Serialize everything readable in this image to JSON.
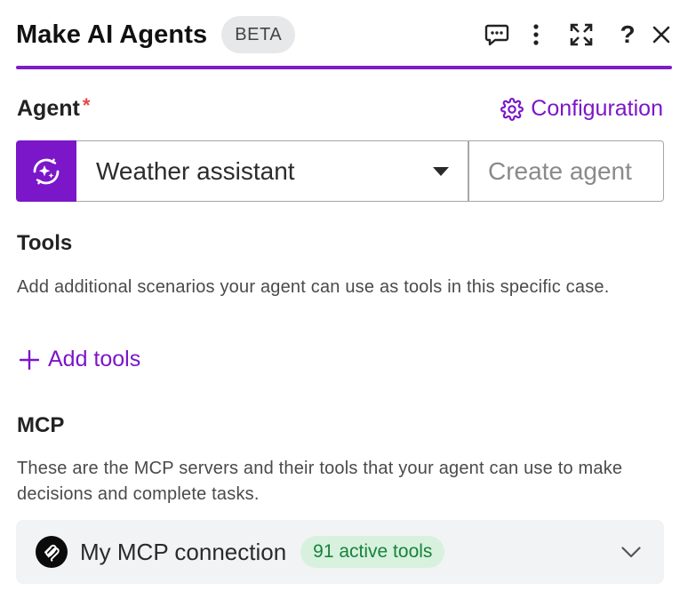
{
  "header": {
    "title": "Make AI Agents",
    "badge": "BETA",
    "icons": [
      "chat-icon",
      "more-vertical-icon",
      "expand-icon",
      "help-icon",
      "close-icon"
    ],
    "help_glyph": "?"
  },
  "agent": {
    "label": "Agent",
    "required_mark": "*",
    "config_link": "Configuration",
    "selected_agent": "Weather assistant",
    "create_button": "Create agent"
  },
  "tools": {
    "title": "Tools",
    "description": "Add additional scenarios your agent can use as tools in this specific case.",
    "add_label": "Add tools"
  },
  "mcp": {
    "title": "MCP",
    "description": "These are the MCP servers and their tools that your agent can use to make decisions and complete tasks.",
    "connection_name": "My MCP connection",
    "active_tools_badge": "91 active tools"
  },
  "colors": {
    "accent": "#7b16c9",
    "divider": "#7f1cc8",
    "required": "#e5484d",
    "badge_bg": "#d7f1de",
    "badge_text": "#17823a"
  }
}
